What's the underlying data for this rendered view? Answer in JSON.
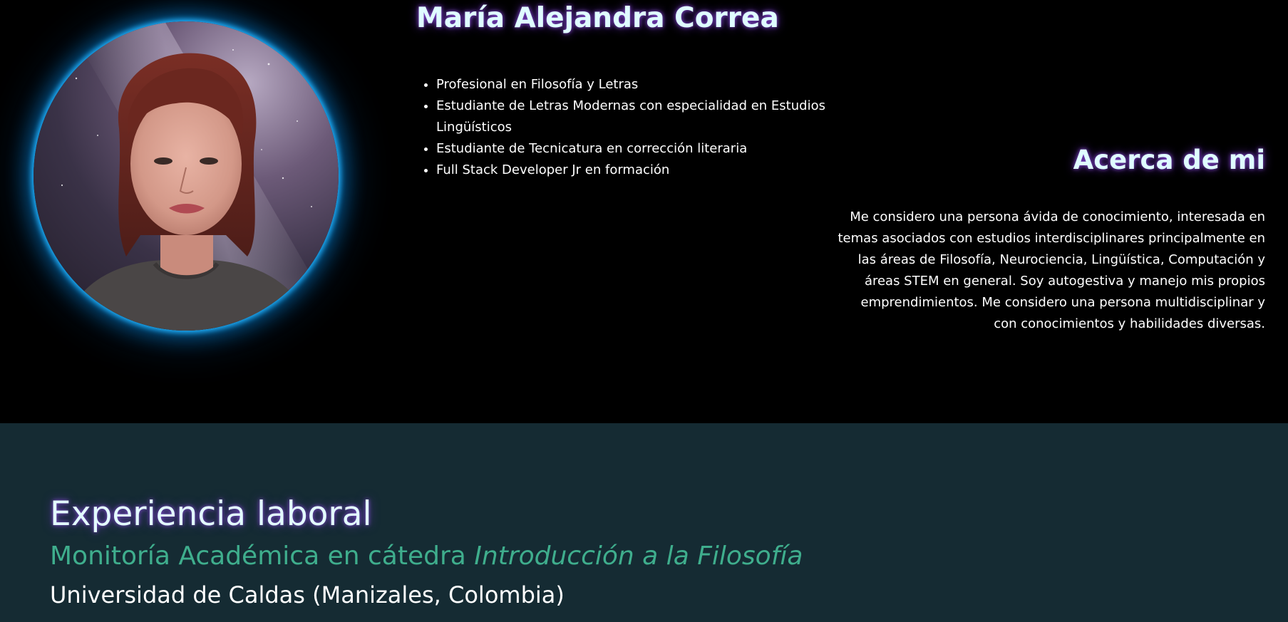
{
  "profile": {
    "name": "María Alejandra Correa",
    "photo_alt": "María Alejandra Correa",
    "qualifications": [
      "Profesional en Filosofía y Letras",
      "Estudiante de Letras Modernas con especialidad en Estudios Lingüísticos",
      "Estudiante de Tecnicatura en corrección literaria",
      "Full Stack Developer Jr en formación"
    ]
  },
  "about": {
    "title": "Acerca de mi",
    "text": "Me considero una persona ávida de conocimiento, interesada en temas asociados con estudios interdisciplinares principalmente en las áreas de Filosofía, Neurociencia, Lingüística, Computación y áreas STEM en general. Soy autogestiva y manejo mis propios emprendimientos. Me considero una persona multidisciplinar y con conocimientos y habilidades diversas."
  },
  "experience": {
    "title": "Experiencia laboral",
    "jobs": [
      {
        "role_prefix": "Monitoría Académica en cátedra",
        "role_course": "Introducción a la Filosofía",
        "place": "Universidad de Caldas (Manizales, Colombia)"
      }
    ]
  },
  "colors": {
    "hero_background": "#000000",
    "experience_background": "#152b33",
    "heading_text": "#dffcff",
    "heading_glow": "#8a4fe0",
    "photo_glow": "#1fb3ff",
    "job_title": "#3fae8d",
    "body_text": "#ffffff"
  }
}
